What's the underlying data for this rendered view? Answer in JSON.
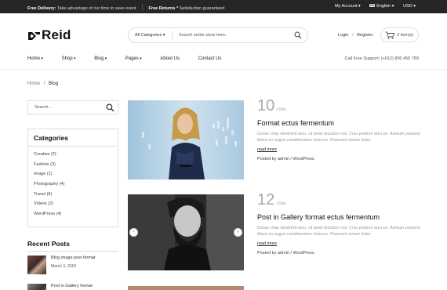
{
  "topbar": {
    "delivery_label": "Free Delivery:",
    "delivery_text": "Take advantage of our time to save event",
    "returns_label": "Free Returns *",
    "returns_text": "Satisfaction guaranteed",
    "account": "My Account",
    "language": "English",
    "currency": "USD"
  },
  "header": {
    "logo": "Reid",
    "search_category": "All Categories",
    "search_placeholder": "Search entire store here..",
    "login": "Login",
    "register": "Register",
    "cart": "2 item(s)"
  },
  "nav": {
    "items": [
      "Home",
      "Shop",
      "Blog",
      "Pages",
      "About Us",
      "Contact Us"
    ],
    "support": "Call Free Support: (+012) 800 456 789"
  },
  "breadcrumb": {
    "home": "Home",
    "separator": "/",
    "current": "Blog"
  },
  "sidebar": {
    "search_placeholder": "Search...",
    "categories_title": "Categories",
    "categories": [
      "Creative (2)",
      "Fashion (3)",
      "Image (1)",
      "Photography (4)",
      "Travel (6)",
      "Videos (2)",
      "WordPress (4)"
    ],
    "recent_title": "Recent Posts",
    "recent": [
      {
        "title": "Blog image post format",
        "date": "March 3, 2018"
      },
      {
        "title": "Post in Gallery format",
        "date": ""
      }
    ]
  },
  "posts": [
    {
      "day": "10",
      "month": "/ Dec",
      "title": "Format ectus fermentum",
      "excerpt": "Donec vitae hendrerit arcu, sit amet faucibus nisl. Cras pretium arcu ex. Aenean posuere libero eu augue condimentum rhoncus. Praesent ornare tortor",
      "read_more": "read more",
      "byline": "Posted by admin / WordPress"
    },
    {
      "day": "12",
      "month": "/ Dec",
      "title": "Post in Gallery format ectus fermentum",
      "excerpt": "Donec vitae hendrerit arcu, sit amet faucibus nisl. Cras pretium arcu ex. Aenean posuere libero eu augue condimentum rhoncus. Praesent ornare tortor",
      "read_more": "read more",
      "byline": "Posted by admin / WordPress"
    }
  ],
  "colors": {
    "topbar": "#262626",
    "date_grey": "#aaaaaa",
    "border": "#dddddd"
  },
  "icons": [
    "search-icon",
    "cart-icon",
    "flag-icon",
    "chevron-left-icon",
    "chevron-right-icon"
  ]
}
